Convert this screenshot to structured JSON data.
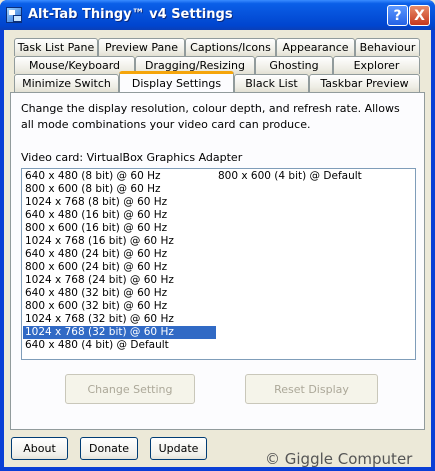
{
  "window": {
    "title": "Alt-Tab Thingy™ v4 Settings",
    "help_label": "?",
    "close_label": "X"
  },
  "tabs": {
    "row1": [
      "Task List Pane",
      "Preview Pane",
      "Captions/Icons",
      "Appearance",
      "Behaviour"
    ],
    "row2": [
      "Mouse/Keyboard",
      "Dragging/Resizing",
      "Ghosting",
      "Explorer"
    ],
    "row3": [
      "Minimize Switch",
      "Display Settings",
      "Black List",
      "Taskbar Preview"
    ],
    "active": "Display Settings"
  },
  "panel": {
    "description": "Change the display resolution, colour depth, and refresh rate. Allows all mode combinations your video card can produce.",
    "video_card": "Video card: VirtualBox Graphics Adapter",
    "modes_col1": [
      "640 x 480 (8 bit) @ 60 Hz",
      "800 x 600 (8 bit) @ 60 Hz",
      "1024 x 768 (8 bit) @ 60 Hz",
      "640 x 480 (16 bit) @ 60 Hz",
      "800 x 600 (16 bit) @ 60 Hz",
      "1024 x 768 (16 bit) @ 60 Hz",
      "640 x 480 (24 bit) @ 60 Hz",
      "800 x 600 (24 bit) @ 60 Hz",
      "1024 x 768 (24 bit) @ 60 Hz",
      "640 x 480 (32 bit) @ 60 Hz",
      "800 x 600 (32 bit) @ 60 Hz",
      "1024 x 768 (32 bit) @ 60 Hz",
      "1024 x 768 (32 bit) @ 60 Hz",
      "640 x 480 (4 bit) @ Default"
    ],
    "modes_col2": [
      "800 x 600 (4 bit) @ Default"
    ],
    "selected_index": 12,
    "change_setting": "Change Setting",
    "reset_display": "Reset Display"
  },
  "footer": {
    "about": "About",
    "donate": "Donate",
    "update": "Update"
  },
  "watermark": "© Giggle Computer",
  "colors": {
    "titlebar": "#0653dc",
    "selection": "#316ac5",
    "active_tab_accent": "#f5a50b"
  }
}
